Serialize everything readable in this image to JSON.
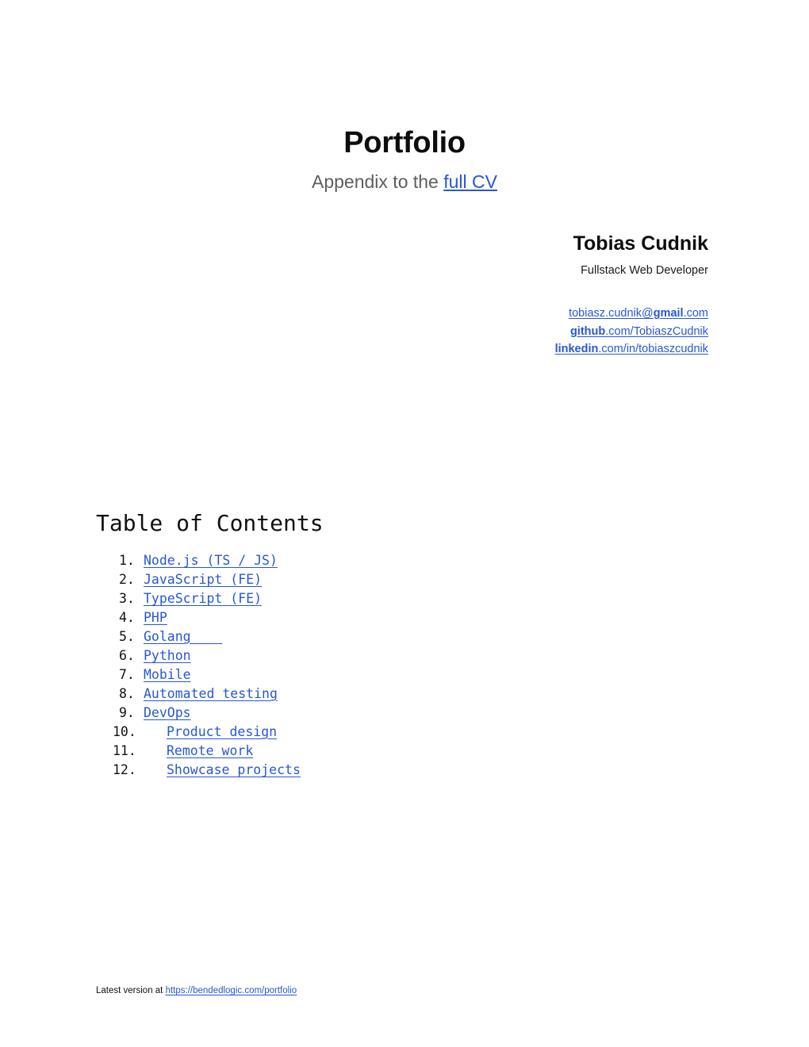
{
  "document": {
    "title": "Portfolio",
    "subtitle_prefix": "Appendix to the ",
    "subtitle_link": "full CV"
  },
  "author": {
    "name": "Tobias Cudnik",
    "role": "Fullstack Web Developer",
    "contacts": [
      {
        "name": "email-link",
        "prefix": "tobiasz.cudnik@",
        "bold": "gmail",
        "suffix": ".com"
      },
      {
        "name": "github-link",
        "prefix": "",
        "bold": "github",
        "suffix": ".com/TobiaszCudnik"
      },
      {
        "name": "linkedin-link",
        "prefix": "",
        "bold": "linkedin",
        "suffix": ".com/in/tobiaszcudnik"
      }
    ]
  },
  "toc": {
    "heading": "Table of Contents",
    "items": [
      {
        "marker": "1.",
        "label": "Node.js (TS / JS)"
      },
      {
        "marker": "2.",
        "label": "JavaScript (FE)"
      },
      {
        "marker": "3.",
        "label": "TypeScript (FE)"
      },
      {
        "marker": "4.",
        "label": "PHP"
      },
      {
        "marker": "5.",
        "label": "Golang    "
      },
      {
        "marker": "6.",
        "label": "Python"
      },
      {
        "marker": "7.",
        "label": "Mobile"
      },
      {
        "marker": "8.",
        "label": "Automated testing"
      },
      {
        "marker": "9.",
        "label": "DevOps"
      },
      {
        "marker": "10.",
        "label": "Product design"
      },
      {
        "marker": "11.",
        "label": "Remote work"
      },
      {
        "marker": "12.",
        "label": "Showcase projects"
      }
    ]
  },
  "footer": {
    "prefix": "Latest version at ",
    "link": "https://bendedlogic.com/portfolio"
  },
  "colors": {
    "link": "#2757d6",
    "subtitle_gray": "#5e5e5e",
    "text": "#111111",
    "background": "#ffffff"
  }
}
